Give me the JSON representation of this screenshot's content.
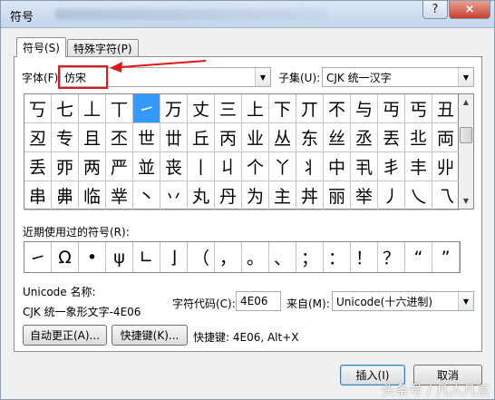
{
  "window": {
    "title": "符号",
    "help_label": "?",
    "close_label": "×"
  },
  "tabs": [
    {
      "label": "符号(S)",
      "active": true
    },
    {
      "label": "特殊字符(P)",
      "active": false
    }
  ],
  "font": {
    "label": "字体(F):",
    "value": "仿宋"
  },
  "subset": {
    "label": "子集(U):",
    "value": "CJK 统一汉字"
  },
  "symbols": {
    "rows": [
      [
        "丂",
        "七",
        "丄",
        "丅",
        "㇀",
        "万",
        "丈",
        "三",
        "上",
        "下",
        "丌",
        "不",
        "与",
        "丏",
        "丐",
        "丑"
      ],
      [
        "丒",
        "专",
        "且",
        "丕",
        "世",
        "丗",
        "丘",
        "丙",
        "业",
        "丛",
        "东",
        "丝",
        "丞",
        "丟",
        "丠",
        "両"
      ],
      [
        "丢",
        "丣",
        "两",
        "严",
        "並",
        "丧",
        "丨",
        "丩",
        "个",
        "丫",
        "丬",
        "中",
        "丮",
        "丯",
        "丰",
        "丱"
      ],
      [
        "串",
        "丳",
        "临",
        "丵",
        "丶",
        "丷",
        "丸",
        "丹",
        "为",
        "主",
        "丼",
        "丽",
        "举",
        "丿",
        "乀",
        "乁"
      ]
    ],
    "selected": "㇀"
  },
  "recent": {
    "label": "近期使用过的符号(R):",
    "items": [
      "㇀",
      "Ω",
      "•",
      "ψ",
      "∟",
      "⌋",
      "（",
      "，",
      "。",
      "、",
      "；",
      "：",
      "！",
      "？",
      "“",
      "”"
    ]
  },
  "unicode": {
    "label": "Unicode 名称:",
    "name": "CJK 统一象形文字-4E06"
  },
  "char_code": {
    "label": "字符代码(C):",
    "value": "4E06"
  },
  "from": {
    "label": "来自(M):",
    "value": "Unicode(十六进制)"
  },
  "buttons": {
    "autocorrect": "自动更正(A)...",
    "shortcut": "快捷键(K)...",
    "shortcut_info": "快捷键: 4E06, Alt+X",
    "insert": "插入(I)",
    "cancel": "取消"
  },
  "watermark": "头条号 / 凡人凡言",
  "colors": {
    "selected": "#3399ff",
    "annotation": "#e0161b"
  }
}
